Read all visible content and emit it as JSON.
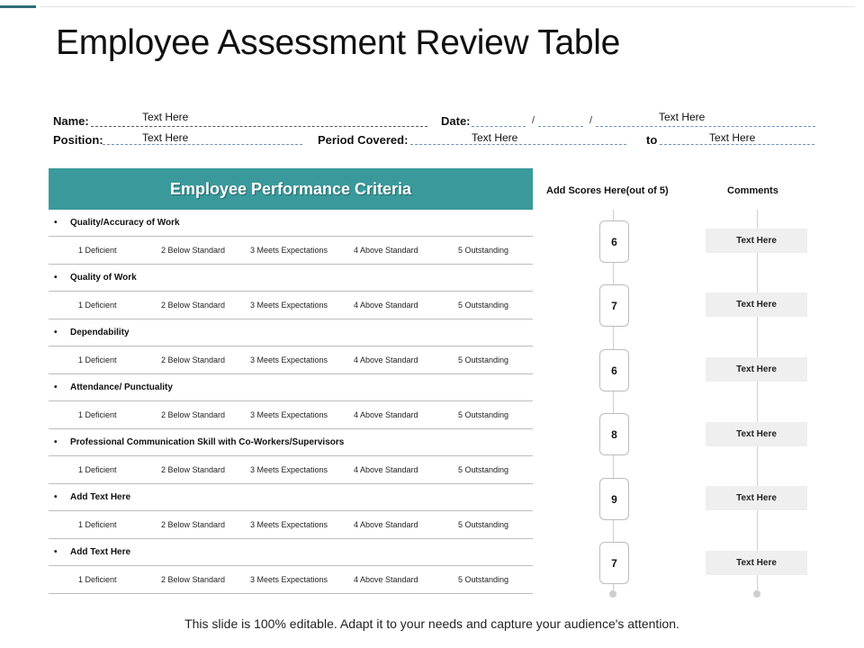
{
  "title": "Employee Assessment Review Table",
  "form": {
    "name_label": "Name:",
    "name_value": "Text Here",
    "date_label": "Date:",
    "date_sep": "/",
    "date_value": "Text Here",
    "position_label": "Position:",
    "position_value": "Text Here",
    "period_label": "Period Covered:",
    "period_value": "Text Here",
    "to_label": "to",
    "to_value": "Text Here"
  },
  "panel": {
    "header": "Employee Performance Criteria",
    "ratings": [
      "1 Deficient",
      "2 Below Standard",
      "3 Meets Expectations",
      "4 Above Standard",
      "5 Outstanding"
    ],
    "criteria": [
      "Quality/Accuracy of Work",
      "Quality of Work",
      "Dependability",
      "Attendance/ Punctuality",
      "Professional Communication Skill with Co-Workers/Supervisors",
      "Add Text Here",
      "Add Text Here"
    ]
  },
  "scores": {
    "header": "Add  Scores Here(out of 5)",
    "values": [
      "6",
      "7",
      "6",
      "8",
      "9",
      "7"
    ]
  },
  "comments": {
    "header": "Comments",
    "values": [
      "Text Here",
      "Text Here",
      "Text Here",
      "Text Here",
      "Text Here",
      "Text Here"
    ]
  },
  "footer": "This slide is 100% editable. Adapt it to your needs and capture your audience's attention."
}
